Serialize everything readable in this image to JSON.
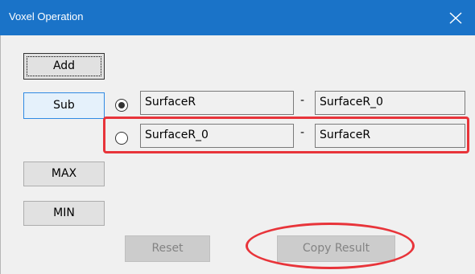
{
  "window": {
    "title": "Voxel Operation",
    "close_icon": "close-icon",
    "title_bar_color": "#1a73c8"
  },
  "buttons": {
    "add": "Add",
    "sub": "Sub",
    "max": "MAX",
    "min": "MIN",
    "reset": "Reset",
    "copy_result": "Copy Result"
  },
  "operations": [
    {
      "selected": true,
      "left": "SurfaceR",
      "operator": "-",
      "right": "SurfaceR_0"
    },
    {
      "selected": false,
      "left": "SurfaceR_0",
      "operator": "-",
      "right": "SurfaceR"
    }
  ],
  "annotations": {
    "highlight_color": "#e8343a"
  }
}
